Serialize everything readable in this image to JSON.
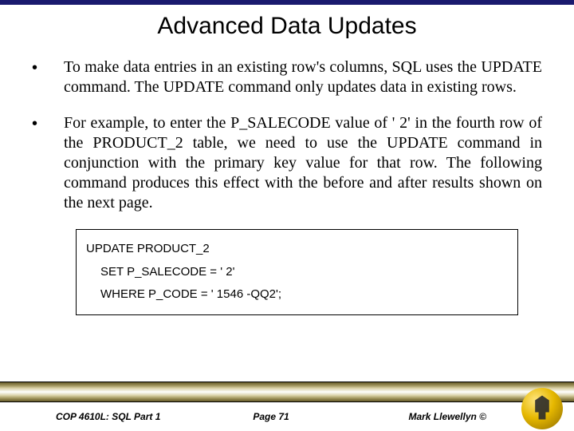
{
  "title": "Advanced Data Updates",
  "bullets": [
    "To make data entries in an existing row's columns, SQL uses the UPDATE command.   The UPDATE command only updates data in existing rows.",
    "For example, to enter the P_SALECODE value of ' 2' in the fourth row of the PRODUCT_2 table, we need to use the UPDATE command in conjunction with the primary key value for that row.  The following command produces this effect with the before and after results shown on the next page."
  ],
  "code": {
    "line1": "UPDATE PRODUCT_2",
    "line2": "SET P_SALECODE = ' 2'",
    "line3": "WHERE P_CODE = ' 1546 -QQ2';"
  },
  "footer": {
    "left": "COP 4610L: SQL Part 1",
    "center": "Page 71",
    "right": "Mark Llewellyn ©"
  }
}
